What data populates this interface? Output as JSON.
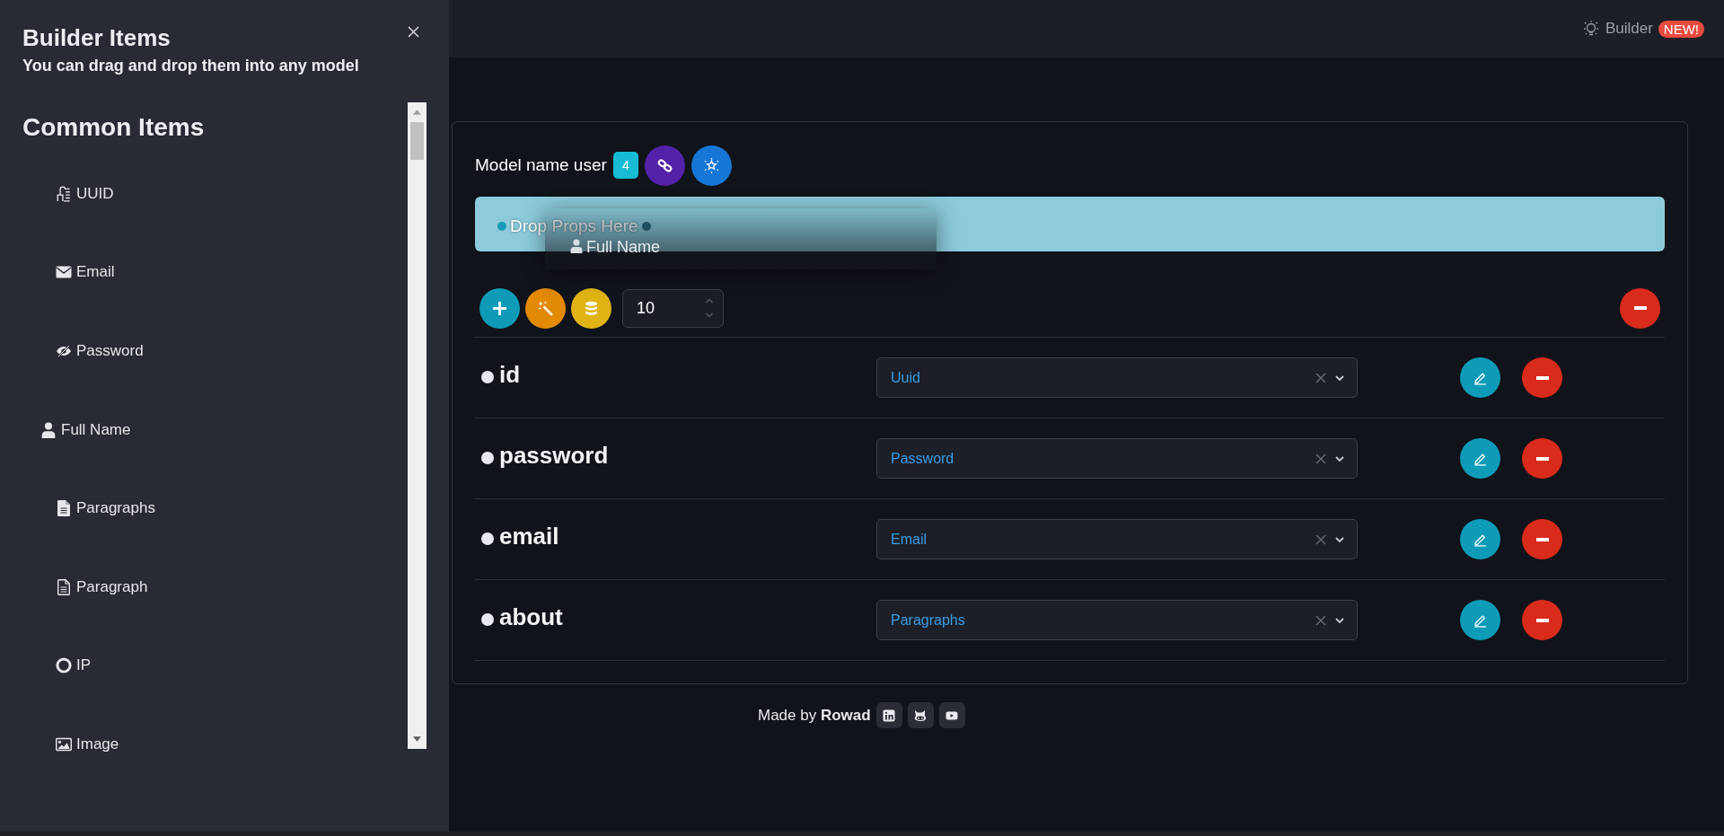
{
  "sidebar": {
    "title": "Builder Items",
    "subtitle": "You can drag and drop them into any model",
    "section_title": "Common Items",
    "items": [
      {
        "label": "UUID",
        "kind": "uuid",
        "dragged": false
      },
      {
        "label": "Email",
        "kind": "email",
        "dragged": false
      },
      {
        "label": "Password",
        "kind": "password",
        "dragged": false
      },
      {
        "label": "Full Name",
        "kind": "person",
        "dragged": true
      },
      {
        "label": "Paragraphs",
        "kind": "paragraphs",
        "dragged": false
      },
      {
        "label": "Paragraph",
        "kind": "paragraph",
        "dragged": false
      },
      {
        "label": "IP",
        "kind": "ip",
        "dragged": false
      },
      {
        "label": "Image",
        "kind": "image",
        "dragged": false
      }
    ]
  },
  "topbar": {
    "link": "Builder",
    "badge": "NEW!"
  },
  "model": {
    "label": "Model name user",
    "count": "4",
    "drop_zone": {
      "text": "Drop Props Here",
      "drag_item": "Full Name"
    },
    "rows_input": "10",
    "fields": [
      {
        "name": "id",
        "type": "Uuid"
      },
      {
        "name": "password",
        "type": "Password"
      },
      {
        "name": "email",
        "type": "Email"
      },
      {
        "name": "about",
        "type": "Paragraphs"
      }
    ]
  },
  "footer": {
    "text": "Made by **Rowad**"
  }
}
